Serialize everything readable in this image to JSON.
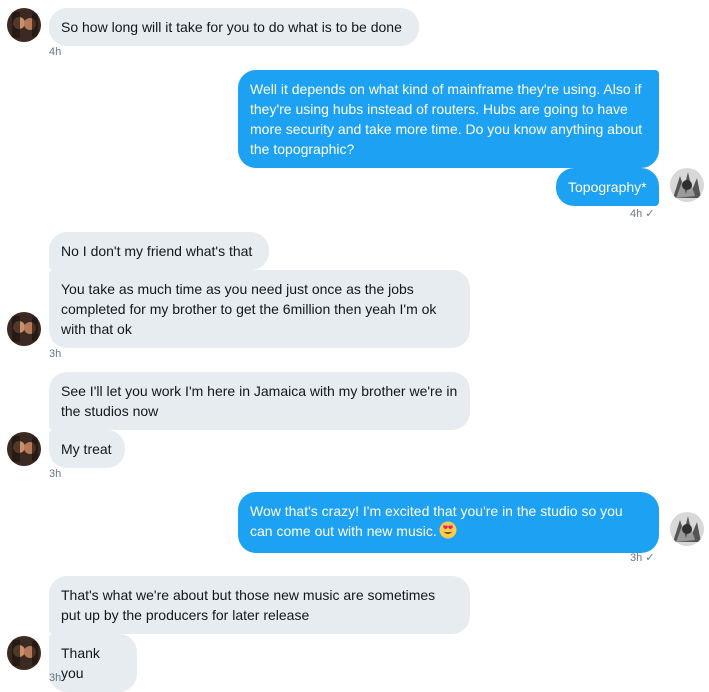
{
  "messages": [
    {
      "text": "So how long will it take for you to do what is to be done"
    },
    {
      "text": "Well it depends on what kind of mainframe they're using. Also if they're using hubs instead of routers. Hubs are going to have more security and take more time. Do you know anything about the topographic?"
    },
    {
      "text": "Topography*"
    },
    {
      "text": "No I don't my friend what's that"
    },
    {
      "text": "You take as much time as you need just once as the jobs completed for my brother to get the 6million then yeah I'm ok with that ok"
    },
    {
      "text": "See I'll let you work I'm here in Jamaica with my brother we're in the studios now"
    },
    {
      "text": "My treat"
    },
    {
      "text": "Wow that's crazy! I'm excited that you're in the studio so you can come out with new music."
    },
    {
      "text": "That's what we're about but those new music are sometimes put up by the producers for later release"
    },
    {
      "text": "Thank you"
    }
  ],
  "timestamps": {
    "t1": "4h",
    "t2": "4h",
    "t3": "3h",
    "t4": "3h",
    "t5": "3h",
    "t6": "3h"
  },
  "read_check": "✓",
  "emoji": {
    "name": "heart-eyes-emoji"
  },
  "colors": {
    "outgoing": "#1da1f2",
    "incoming": "#e6ecf0",
    "timestamp": "#657786"
  }
}
